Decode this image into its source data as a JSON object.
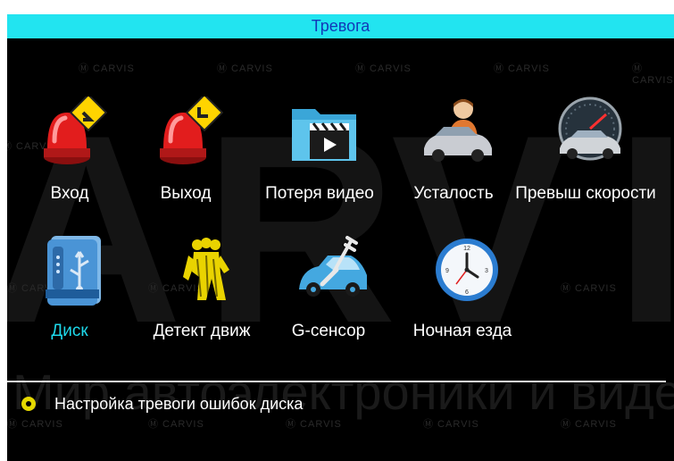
{
  "header": {
    "title": "Тревога"
  },
  "watermark": {
    "big_text": "ARVIS",
    "small_text": "CARVIS",
    "bottom_text": "Мир автоэлектроники и видеонаблюдения"
  },
  "menu": {
    "items": [
      {
        "label": "Вход",
        "icon": "alarm-siren-enter-icon",
        "selected": false
      },
      {
        "label": "Выход",
        "icon": "alarm-siren-exit-icon",
        "selected": false
      },
      {
        "label": "Потеря видео",
        "icon": "video-folder-icon",
        "selected": false
      },
      {
        "label": "Усталость",
        "icon": "driver-fatigue-icon",
        "selected": false
      },
      {
        "label": "Превыш скорости",
        "icon": "speeding-car-icon",
        "selected": false
      },
      {
        "label": "Диск",
        "icon": "usb-disk-icon",
        "selected": true
      },
      {
        "label": "Детект движ",
        "icon": "motion-detect-icon",
        "selected": false
      },
      {
        "label": "G-сенсор",
        "icon": "g-sensor-car-icon",
        "selected": false
      },
      {
        "label": "Ночная езда",
        "icon": "clock-icon",
        "selected": false
      }
    ]
  },
  "setting": {
    "label": "Настройка тревоги ошибок диска",
    "checked": true
  },
  "colors": {
    "titlebar": "#22e4f0",
    "title_text": "#1238b8",
    "selected": "#1ed8ea",
    "radio": "#e5d800"
  }
}
